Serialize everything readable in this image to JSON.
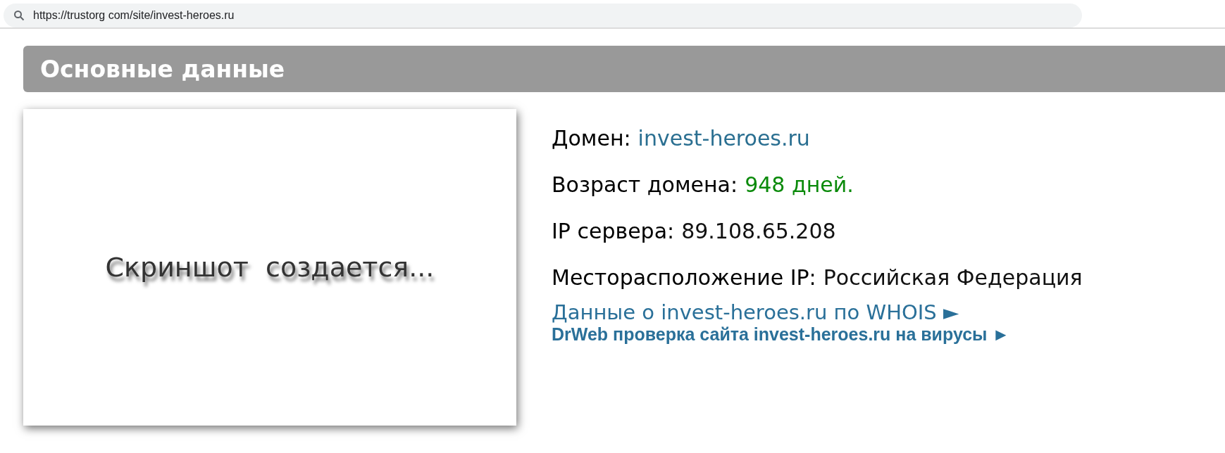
{
  "address_bar": {
    "url": "https://trustorg com/site/invest-heroes.ru"
  },
  "section": {
    "title": "Основные данные"
  },
  "screenshot_placeholder": {
    "text": "Скриншот  создается..."
  },
  "fields": [
    {
      "label": "Домен:",
      "value": "invest-heroes.ru",
      "kind": "link"
    },
    {
      "label": "Возраст домена:",
      "value": "948 дней.",
      "kind": "good"
    },
    {
      "label": "IP сервера:",
      "value": "89.108.65.208",
      "kind": "plain"
    },
    {
      "label": "Месторасположение IP:",
      "value": "Российская Федерация",
      "kind": "plain"
    }
  ],
  "links": [
    {
      "text": "Данные о invest-heroes.ru по WHOIS ►",
      "kind": "large"
    },
    {
      "text": "DrWeb проверка сайта invest-heroes.ru на вирусы ►",
      "kind": "small"
    }
  ]
}
